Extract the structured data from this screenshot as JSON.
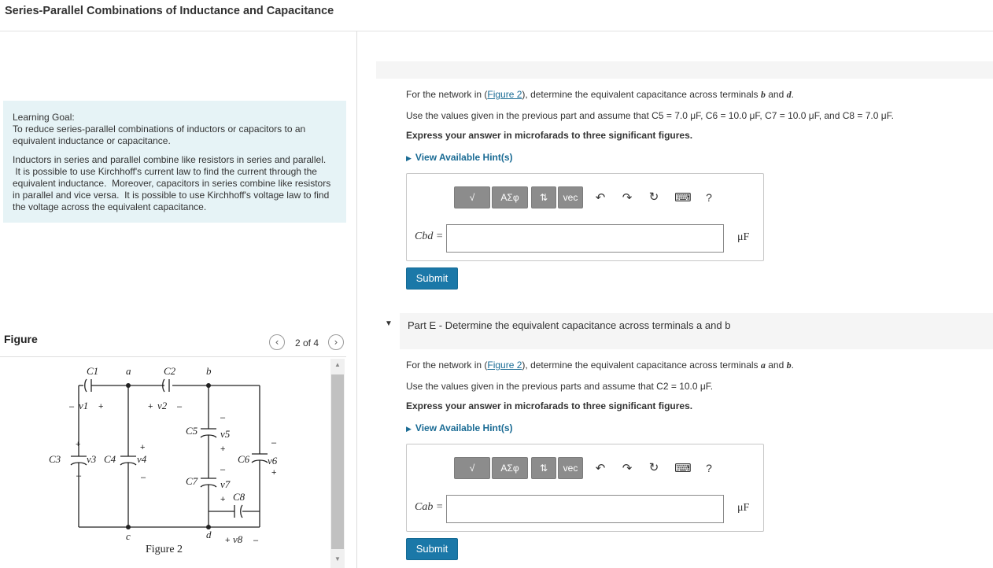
{
  "page": {
    "title": "Series-Parallel Combinations of Inductance and Capacitance"
  },
  "learning_goal": {
    "heading": "Learning Goal:",
    "line1": "To reduce series-parallel combinations of inductors or capacitors to an",
    "line2": "equivalent inductance or capacitance.",
    "p1": "Inductors in series and parallel combine like resistors in series and parallel.",
    "p2": " It is possible to use Kirchhoff's current law to find the current through the",
    "p3": "equivalent inductance.  Moreover, capacitors in series combine like resistors",
    "p4": "in parallel and vice versa.  It is possible to use Kirchhoff's voltage law to find",
    "p5": "the voltage across the equivalent capacitance."
  },
  "figure": {
    "label": "Figure",
    "counter": "2 of 4",
    "caption": "Figure 2",
    "nodes": {
      "a": "a",
      "b": "b",
      "c": "c",
      "d": "d"
    },
    "caps": {
      "c1": "C1",
      "c2": "C2",
      "c3": "C3",
      "c4": "C4",
      "c5": "C5",
      "c6": "C6",
      "c7": "C7",
      "c8": "C8"
    },
    "volts": {
      "v1": "v1",
      "v2": "v2",
      "v3": "v3",
      "v4": "v4",
      "v5": "v5",
      "v6": "v6",
      "v7": "v7",
      "v8": "v8"
    }
  },
  "icons": {
    "prev": "‹",
    "next": "›",
    "scroll_up": "▲",
    "scroll_down": "▼",
    "hint_triangle": "▶",
    "part_caret": "▼",
    "undo": "↶",
    "redo": "↷",
    "reset": "↻",
    "keyboard": "⌨",
    "help": "?",
    "sqrt": "√",
    "greek": "ΑΣφ",
    "arrows": "⇅",
    "vec": "vec"
  },
  "part_d": {
    "q_prefix": "For the network in (",
    "q_link": "Figure 2",
    "q_suffix": "), determine the equivalent capacitance across terminals ",
    "q_term1": "b",
    "q_and": " and ",
    "q_term2": "d",
    "q_end": ".",
    "values": "Use the values given in the previous part and assume that C5 = 7.0 μF, C6 = 10.0 μF, C7 = 10.0 μF, and C8 = 7.0 μF.",
    "instruction": "Express your answer in microfarads to three significant figures.",
    "hint": "View Available Hint(s)",
    "label": "Cbd =",
    "unit": "μF",
    "submit": "Submit"
  },
  "part_e": {
    "title": "Part E - Determine the equivalent capacitance across terminals a and b",
    "q_prefix": "For the network in (",
    "q_link": "Figure 2",
    "q_suffix": "), determine the equivalent capacitance across terminals ",
    "q_term1": "a",
    "q_and": " and ",
    "q_term2": "b",
    "q_end": ".",
    "values": "Use the values given in the previous parts and assume that C2 = 10.0 μF.",
    "instruction": "Express your answer in microfarads to three significant figures.",
    "hint": "View Available Hint(s)",
    "label": "Cab =",
    "unit": "μF",
    "submit": "Submit"
  }
}
